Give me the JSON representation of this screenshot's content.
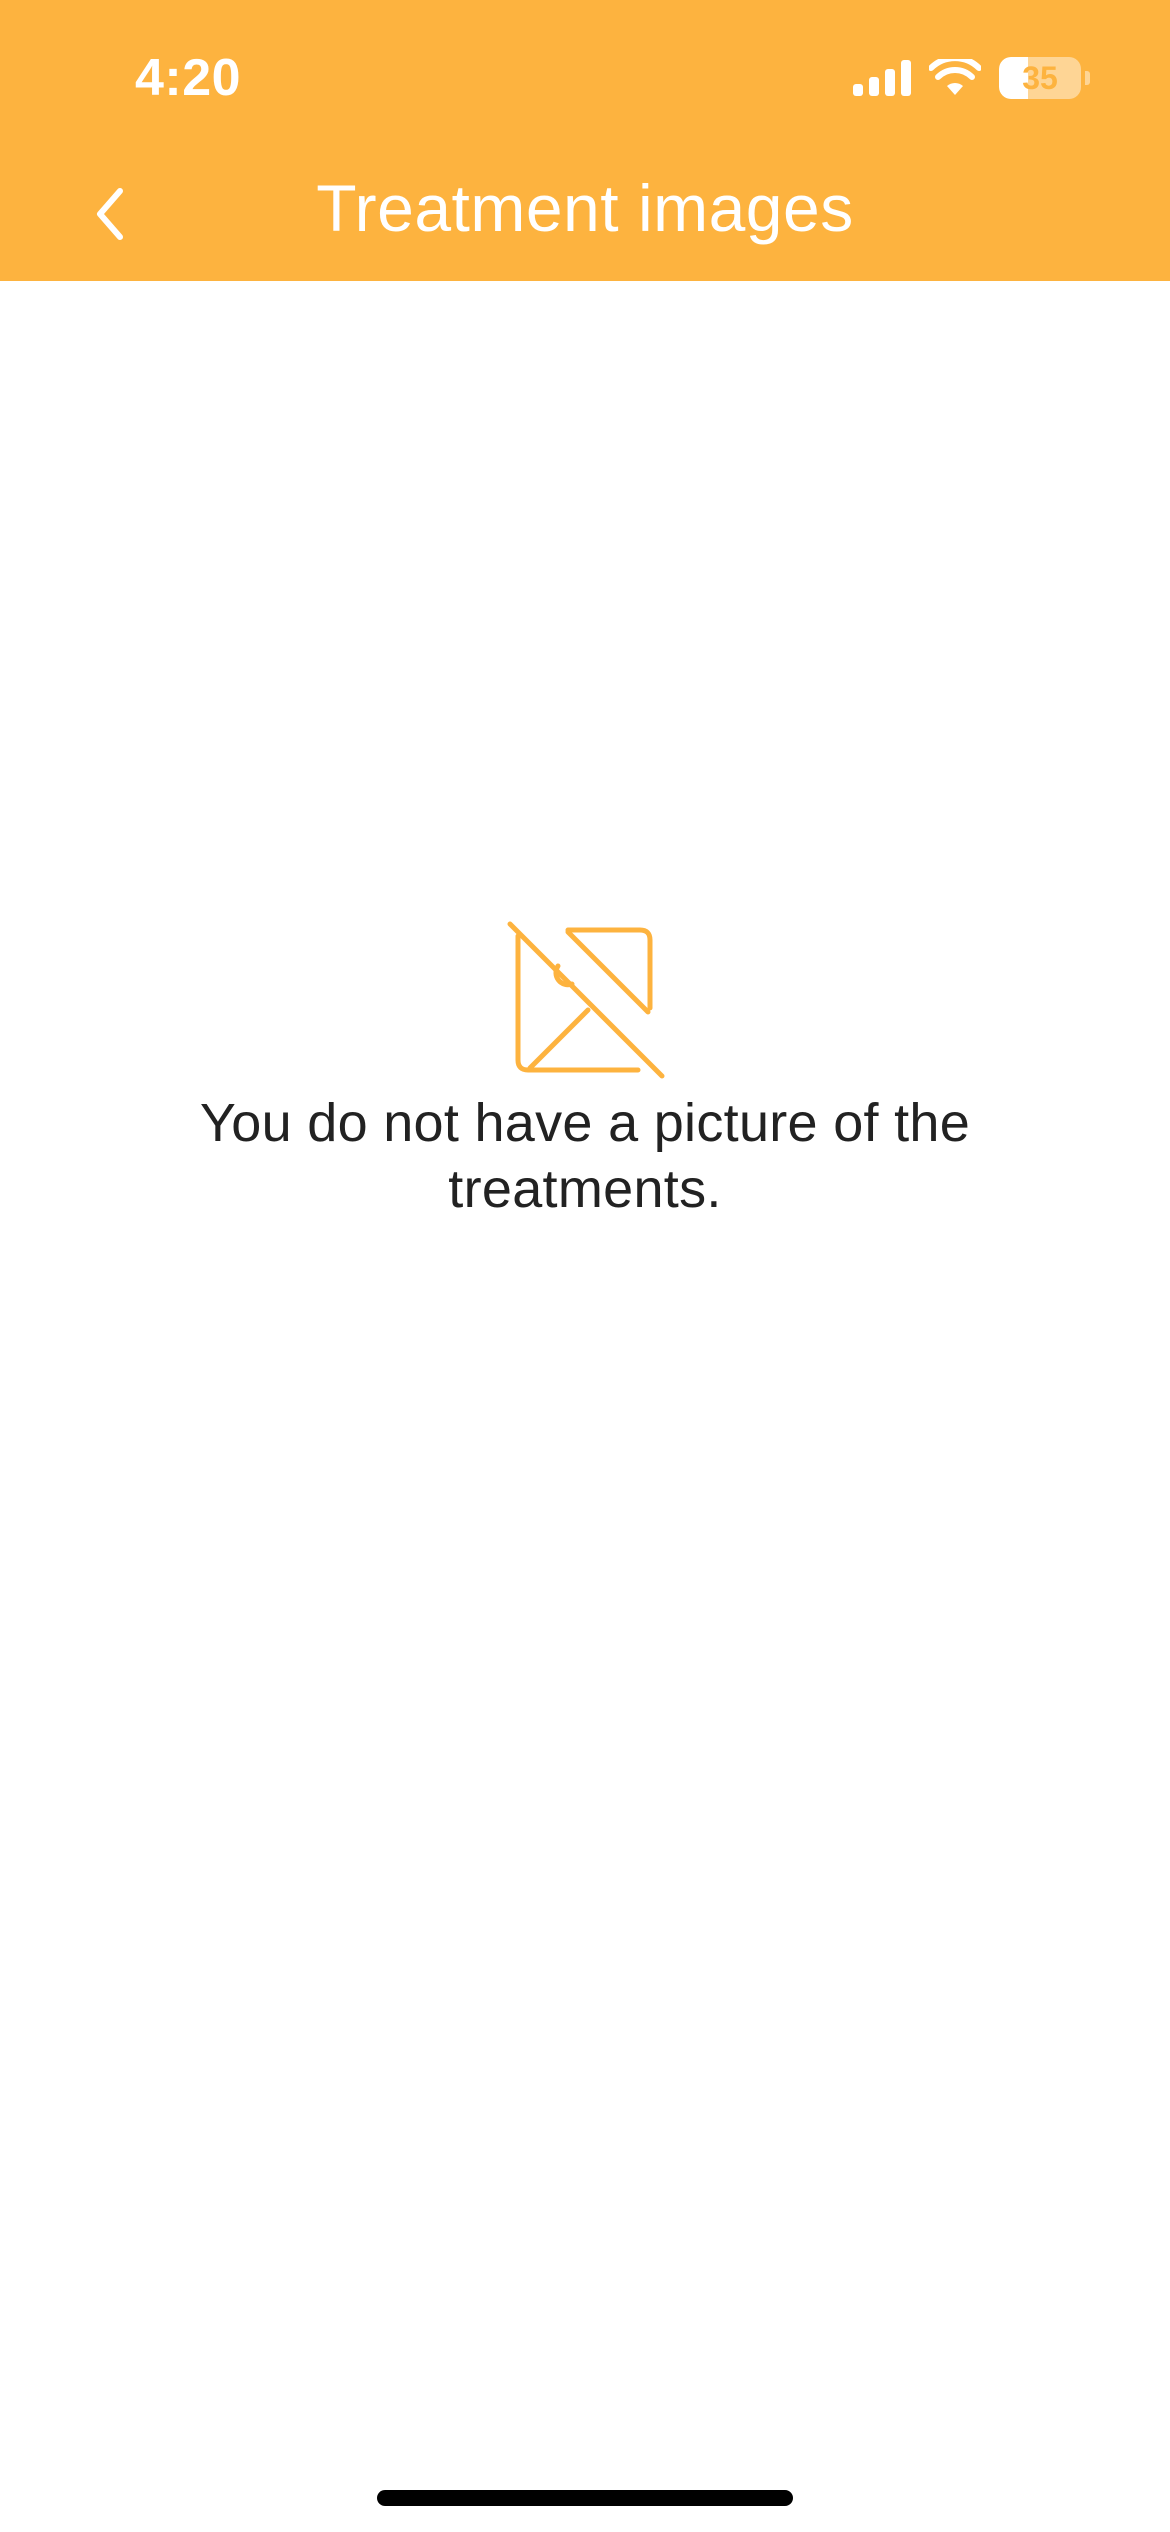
{
  "status_bar": {
    "time": "4:20",
    "battery_level": "35",
    "battery_fraction": 0.35,
    "icons": [
      "signal-icon",
      "wifi-icon",
      "battery-icon"
    ]
  },
  "nav": {
    "title": "Treatment images",
    "back_icon": "chevron-left-icon"
  },
  "empty_state": {
    "icon": "no-image-icon",
    "message": "You do not have a picture of the treatments."
  },
  "colors": {
    "accent": "#FDB33F",
    "text": "#222222",
    "background": "#FFFFFF"
  }
}
